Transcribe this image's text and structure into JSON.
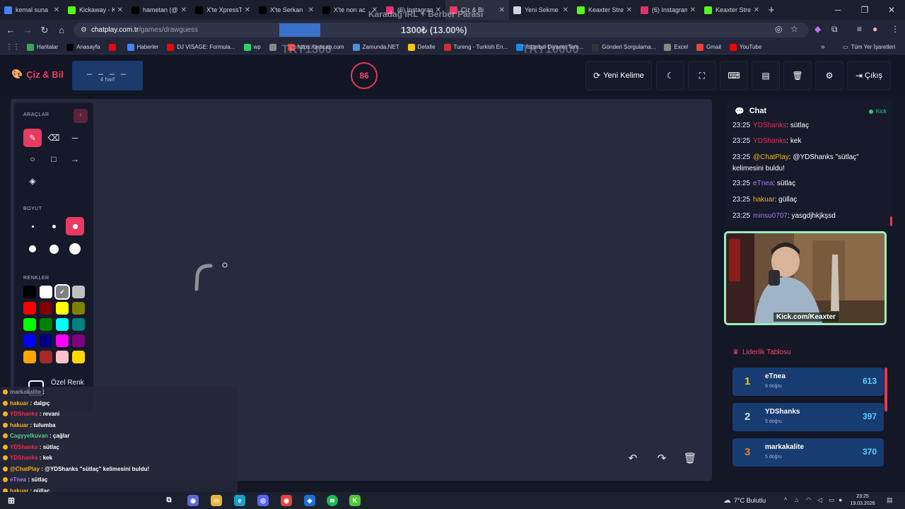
{
  "browser": {
    "tabs": [
      {
        "title": "kemal suna",
        "icon": "google-icon",
        "color": "#4285f4"
      },
      {
        "title": "Kickaway - K",
        "icon": "kick-icon",
        "color": "#53fc18"
      },
      {
        "title": "hametan (@",
        "icon": "x-icon",
        "color": "#000000"
      },
      {
        "title": "X'te XpressT",
        "icon": "x-icon",
        "color": "#000000"
      },
      {
        "title": "X'te Serkan",
        "icon": "x-icon",
        "color": "#000000"
      },
      {
        "title": "X'te non ac",
        "icon": "x-icon",
        "color": "#000000"
      },
      {
        "title": "(6) Instagram",
        "icon": "instagram-icon",
        "color": "#e1306c"
      },
      {
        "title": "Çiz & Bi",
        "icon": "chatplay-icon",
        "color": "#e83b62",
        "active": true
      },
      {
        "title": "Yeni Sekme",
        "icon": "chrome-icon",
        "color": "#cfd3df"
      },
      {
        "title": "Keaxter Stre",
        "icon": "kick-icon",
        "color": "#53fc18"
      },
      {
        "title": "(6) Instagram",
        "icon": "instagram-icon",
        "color": "#e1306c"
      },
      {
        "title": "Keaxter Stre",
        "icon": "kick-icon",
        "color": "#53fc18"
      }
    ],
    "url_host": "chatplay.com.tr",
    "url_path": "/games/drawguess",
    "bookmarks": [
      {
        "label": "Haritalar",
        "color": "#34a853"
      },
      {
        "label": "Anasayfa",
        "color": "#000000"
      },
      {
        "label": "",
        "color": "#ff0000"
      },
      {
        "label": "Haberler",
        "color": "#4285f4"
      },
      {
        "label": "DJ VISAGE: Formula...",
        "color": "#ff0000"
      },
      {
        "label": "wp",
        "color": "#25d366"
      },
      {
        "label": "",
        "color": "#888888"
      },
      {
        "label": "https://aracap.com",
        "color": "#e53935"
      },
      {
        "label": "Zamunda.NET",
        "color": "#4a90d9"
      },
      {
        "label": "Detalle",
        "color": "#f5c518"
      },
      {
        "label": "Tureng - Turkish En...",
        "color": "#d32f2f"
      },
      {
        "label": "İstanbul Diyanet Tem...",
        "color": "#1e88e5"
      },
      {
        "label": "Gönderi Sorgulama...",
        "color": "#333333"
      },
      {
        "label": "Excel",
        "color": "#888888"
      },
      {
        "label": "Gmail",
        "color": "#ea4335"
      },
      {
        "label": "YouTube",
        "color": "#ff0000"
      }
    ],
    "all_bookmarks_label": "Tüm Yer İşaretleri"
  },
  "stream_overlay": {
    "title": "Karadağ IRL + Berber Parası",
    "goal": "1300₺ (13.00%)",
    "try_left": "TRY1300",
    "try_right": "TRY10000"
  },
  "game": {
    "logo": "Çiz & Bil",
    "word_mask": "_ _ _ _",
    "word_length": "4 harf",
    "timer": "86",
    "new_word_label": "Yeni Kelime",
    "exit_label": "Çıkış"
  },
  "tools": {
    "title": "ARAÇLAR",
    "size_title": "BOYUT",
    "colors_title": "RENKLER",
    "custom_color_label": "Özel Renk",
    "swatches": [
      "#000000",
      "#ffffff",
      "#808080",
      "#c0c0c0",
      "#ff0000",
      "#800000",
      "#ffff00",
      "#808000",
      "#00ff00",
      "#008000",
      "#00ffff",
      "#008080",
      "#0000ff",
      "#000080",
      "#ff00ff",
      "#800080",
      "#ffa500",
      "#a52a2a",
      "#ffc0cb",
      "#ffd700"
    ],
    "selected_swatch": 2
  },
  "overlay_chat": [
    {
      "user": "markakalite",
      "text": "",
      "color": "#8b8fa3"
    },
    {
      "user": "hakuar",
      "text": "dalgıç",
      "color": "#f5b21b"
    },
    {
      "user": "YDShanks",
      "text": "revani",
      "color": "#e0304f"
    },
    {
      "user": "hakuar",
      "text": "tulumba",
      "color": "#f5b21b"
    },
    {
      "user": "Cagyyelkuvan",
      "text": "çağlar",
      "color": "#4fd08a"
    },
    {
      "user": "YDShanks",
      "text": "sütlaç",
      "color": "#e0304f"
    },
    {
      "user": "YDShanks",
      "text": "kek",
      "color": "#e0304f"
    },
    {
      "user": "@ChatPlay",
      "text": "@YDShanks \"sütlaç\" kelimesini buldu!",
      "color": "#f5b21b"
    },
    {
      "user": "eTnea",
      "text": "sütlaç",
      "color": "#a678f0"
    },
    {
      "user": "hakuar",
      "text": "güllaç",
      "color": "#f5b21b"
    },
    {
      "user": "minsu0707",
      "text": "yasgdjhkjkşsd",
      "color": "#a678f0"
    }
  ],
  "chat": {
    "title": "Chat",
    "platform": "Kick",
    "messages": [
      {
        "time": "23:25",
        "user": "YDShanks",
        "text": "sütlaç",
        "color": "#e0304f"
      },
      {
        "time": "23:25",
        "user": "YDShanks",
        "text": "kek",
        "color": "#e0304f"
      },
      {
        "time": "23:25",
        "user": "@ChatPlay",
        "text": "@YDShanks \"sütlaç\" kelimesini buldu!",
        "color": "#f5b21b"
      },
      {
        "time": "23:25",
        "user": "eTnea",
        "text": "sütlaç",
        "color": "#a678f0"
      },
      {
        "time": "23:25",
        "user": "hakuar",
        "text": "güllaç",
        "color": "#f5b21b"
      },
      {
        "time": "23:25",
        "user": "minsu0707",
        "text": "yasgdjhkjkşsd",
        "color": "#a678f0"
      }
    ]
  },
  "webcam": {
    "label": "Kick.com/Keaxter"
  },
  "leaderboard": {
    "title": "Liderlik Tablosu",
    "rows": [
      {
        "rank": "1",
        "name": "eTnea",
        "sub": "9 doğru",
        "score": "613",
        "rank_color": "#f5c518"
      },
      {
        "rank": "2",
        "name": "YDShanks",
        "sub": "5 doğru",
        "score": "397",
        "rank_color": "#d7dbe6"
      },
      {
        "rank": "3",
        "name": "markakalite",
        "sub": "5 doğru",
        "score": "370",
        "rank_color": "#e0803a"
      }
    ]
  },
  "taskbar": {
    "weather": "7°C Bulutlu",
    "time": "23:25",
    "date": "19.03.2026"
  }
}
